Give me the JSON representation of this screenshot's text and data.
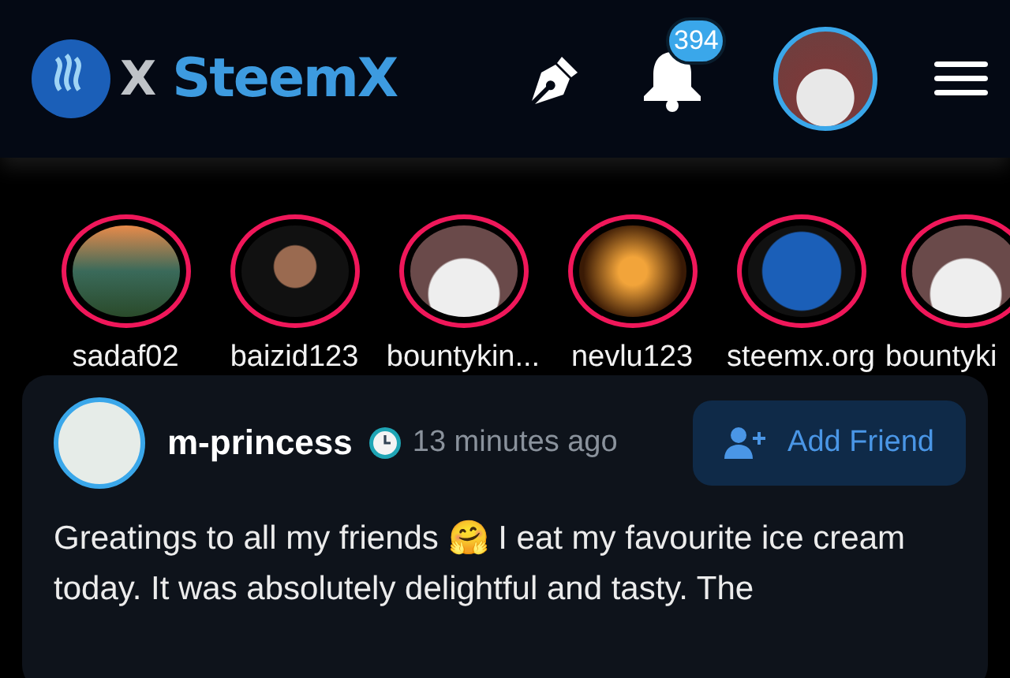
{
  "header": {
    "logo": {
      "letter": "X",
      "name": "SteemX"
    },
    "notification_count": "394"
  },
  "stories": [
    {
      "name": "sadaf02"
    },
    {
      "name": "baizid123"
    },
    {
      "name": "bountykin..."
    },
    {
      "name": "nevlu123"
    },
    {
      "name": "steemx.org"
    },
    {
      "name": "bountyki"
    }
  ],
  "post": {
    "author": "m-princess",
    "time": "13 minutes ago",
    "add_friend": "Add Friend",
    "body": "Greatings to all my friends 🤗 I eat my favourite ice cream today. It was absolutely delightful and tasty. The"
  }
}
